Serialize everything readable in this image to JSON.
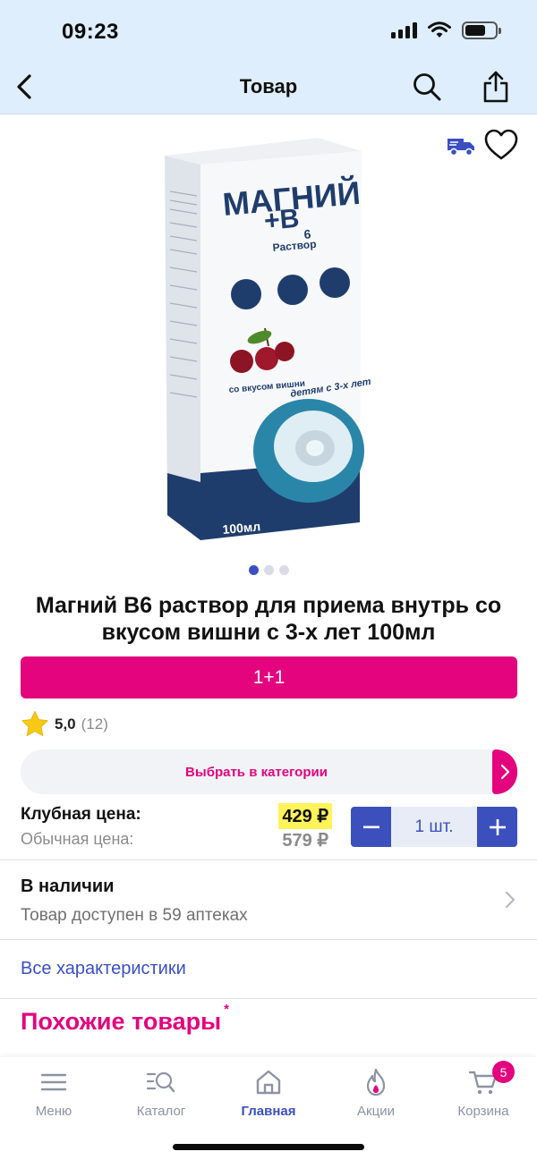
{
  "status_bar": {
    "time": "09:23"
  },
  "header": {
    "title": "Товар"
  },
  "product": {
    "name": "Магний B6 раствор для приема внутрь со вкусом вишни с 3-х лет 100мл",
    "image_count": 3,
    "active_image": 1,
    "box": {
      "brand": "МАГНИЙ",
      "plus": "+B",
      "sub": "6",
      "form": "Раствор",
      "flavor": "со вкусом вишни",
      "age": "детям с 3-х лет",
      "volume": "100мл"
    }
  },
  "promo": {
    "label": "1+1"
  },
  "rating": {
    "value": "5,0",
    "count": "(12)"
  },
  "category_button": {
    "label": "Выбрать в категории"
  },
  "prices": {
    "club_label": "Клубная цена:",
    "club_value": "429 ₽",
    "regular_label": "Обычная цена:",
    "regular_value": "579 ₽"
  },
  "quantity": {
    "value": "1 шт."
  },
  "availability": {
    "title": "В наличии",
    "subtitle": "Товар доступен в 59 аптеках"
  },
  "links": {
    "all_characteristics": "Все характеристики"
  },
  "similar": {
    "title": "Похожие товары",
    "mark": "*"
  },
  "tabbar": {
    "items": [
      {
        "label": "Меню"
      },
      {
        "label": "Каталог"
      },
      {
        "label": "Главная"
      },
      {
        "label": "Акции"
      },
      {
        "label": "Корзина"
      }
    ],
    "cart_badge": "5"
  },
  "colors": {
    "accent_pink": "#e3047e",
    "accent_blue": "#3a4fc2",
    "header_bg": "#deeefc",
    "price_highlight": "#fff35a"
  }
}
